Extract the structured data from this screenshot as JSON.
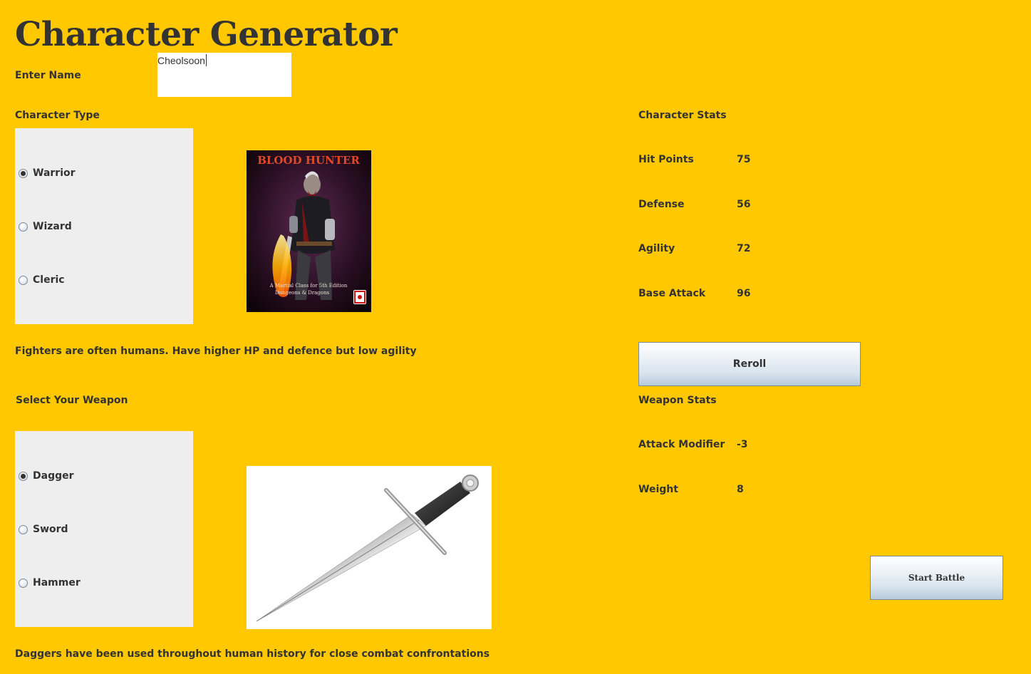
{
  "app": {
    "title": "Character Generator"
  },
  "name": {
    "label": "Enter Name",
    "value": "Cheolsoon"
  },
  "character_type": {
    "heading": "Character Type",
    "options": [
      "Warrior",
      "Wizard",
      "Cleric"
    ],
    "selected": "Warrior",
    "description": "Fighters are often humans. Have higher HP and defence but low agility",
    "image": {
      "title_text": "BLOOD HUNTER",
      "subtitle_line1": "A Martial Class for 5th Edition",
      "subtitle_line2": "Dungeons & Dragons"
    }
  },
  "character_stats": {
    "heading": "Character Stats",
    "rows": [
      {
        "label": "Hit Points",
        "value": "75"
      },
      {
        "label": "Defense",
        "value": "56"
      },
      {
        "label": "Agility",
        "value": "72"
      },
      {
        "label": "Base Attack",
        "value": "96"
      }
    ],
    "reroll_label": "Reroll"
  },
  "weapon": {
    "heading": "Select Your Weapon",
    "options": [
      "Dagger",
      "Sword",
      "Hammer"
    ],
    "selected": "Dagger",
    "description": "Daggers have been used throughout human history for close combat confrontations",
    "image_icon": "dagger-icon"
  },
  "weapon_stats": {
    "heading": "Weapon Stats",
    "rows": [
      {
        "label": "Attack Modifier",
        "value": "-3"
      },
      {
        "label": "Weight",
        "value": "8"
      }
    ]
  },
  "actions": {
    "start_battle_label": "Start Battle"
  },
  "colors": {
    "background": "#ffc800",
    "panel": "#eeeeee",
    "text": "#333333"
  }
}
